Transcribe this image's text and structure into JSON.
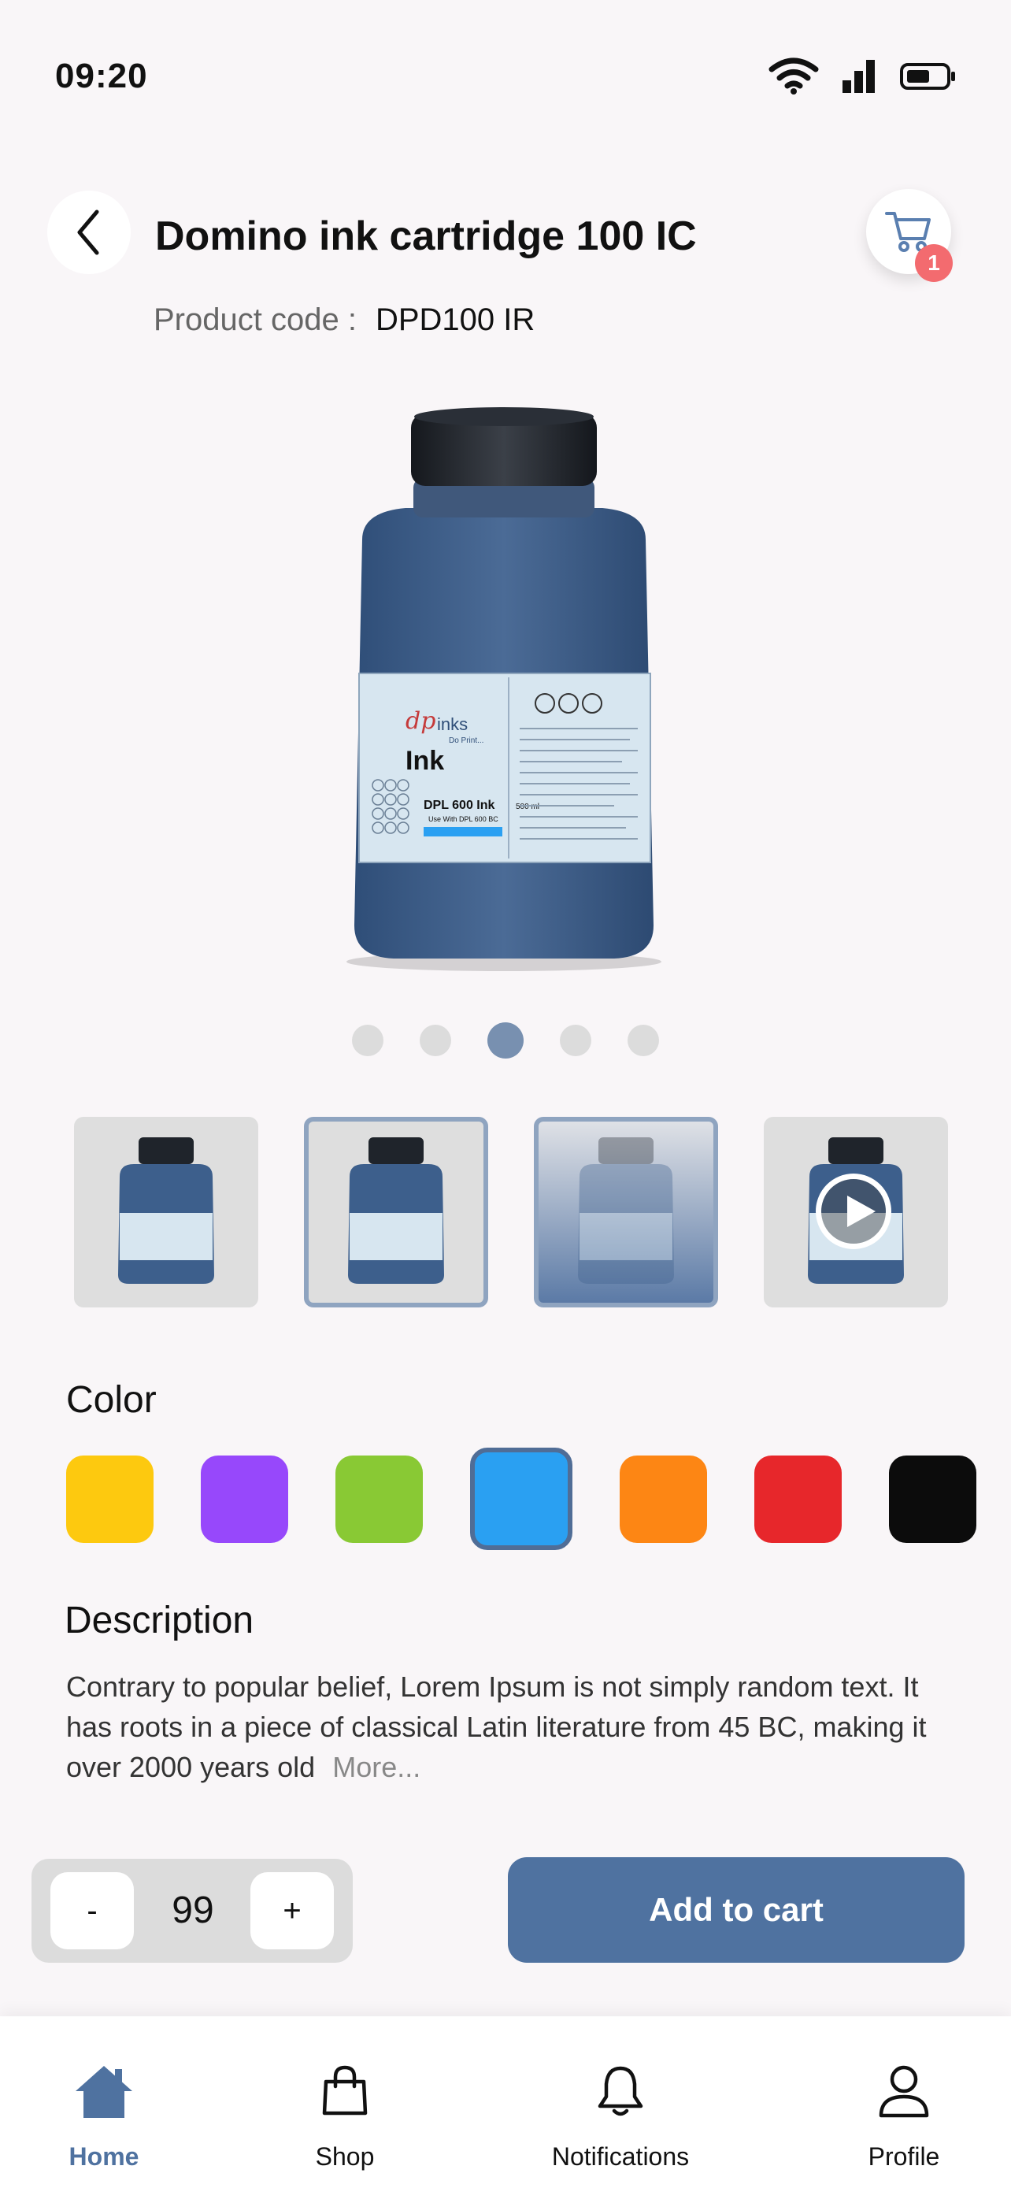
{
  "status_bar": {
    "time": "09:20"
  },
  "header": {
    "title": "Domino ink cartridge 100 IC",
    "cart_badge": "1",
    "product_code_label": "Product code :",
    "product_code_value": "DPD100 IR"
  },
  "product_image_label": {
    "brand": "inks",
    "tagline": "Do Print...",
    "name": "Ink",
    "model": "DPL 600 Ink",
    "volume": "500 ml",
    "use_with": "Use With DPL 600 BC"
  },
  "carousel": {
    "count": 5,
    "active_index": 2
  },
  "thumbnails": [
    {
      "state": "normal"
    },
    {
      "state": "selected"
    },
    {
      "state": "dimmed"
    },
    {
      "state": "video"
    }
  ],
  "color": {
    "label": "Color",
    "options": [
      "#fdc90f",
      "#9748fb",
      "#89c934",
      "#2aa0f2",
      "#fd8614",
      "#e7272b",
      "#0c0c0c"
    ],
    "selected_index": 3
  },
  "description": {
    "label": "Description",
    "text": "Contrary to popular belief, Lorem Ipsum is not simply random text. It has roots in a piece of classical Latin literature from 45 BC, making it over 2000 years old",
    "more": "More..."
  },
  "quantity": {
    "minus": "-",
    "value": "99",
    "plus": "+"
  },
  "add_to_cart": "Add to cart",
  "nav": {
    "items": [
      {
        "label": "Home",
        "icon": "home-icon"
      },
      {
        "label": "Shop",
        "icon": "bag-icon"
      },
      {
        "label": "Notifications",
        "icon": "bell-icon"
      },
      {
        "label": "Profile",
        "icon": "user-icon"
      }
    ],
    "active": "Home"
  },
  "colors": {
    "accent": "#4f72a0",
    "badge": "#f36b6f"
  }
}
